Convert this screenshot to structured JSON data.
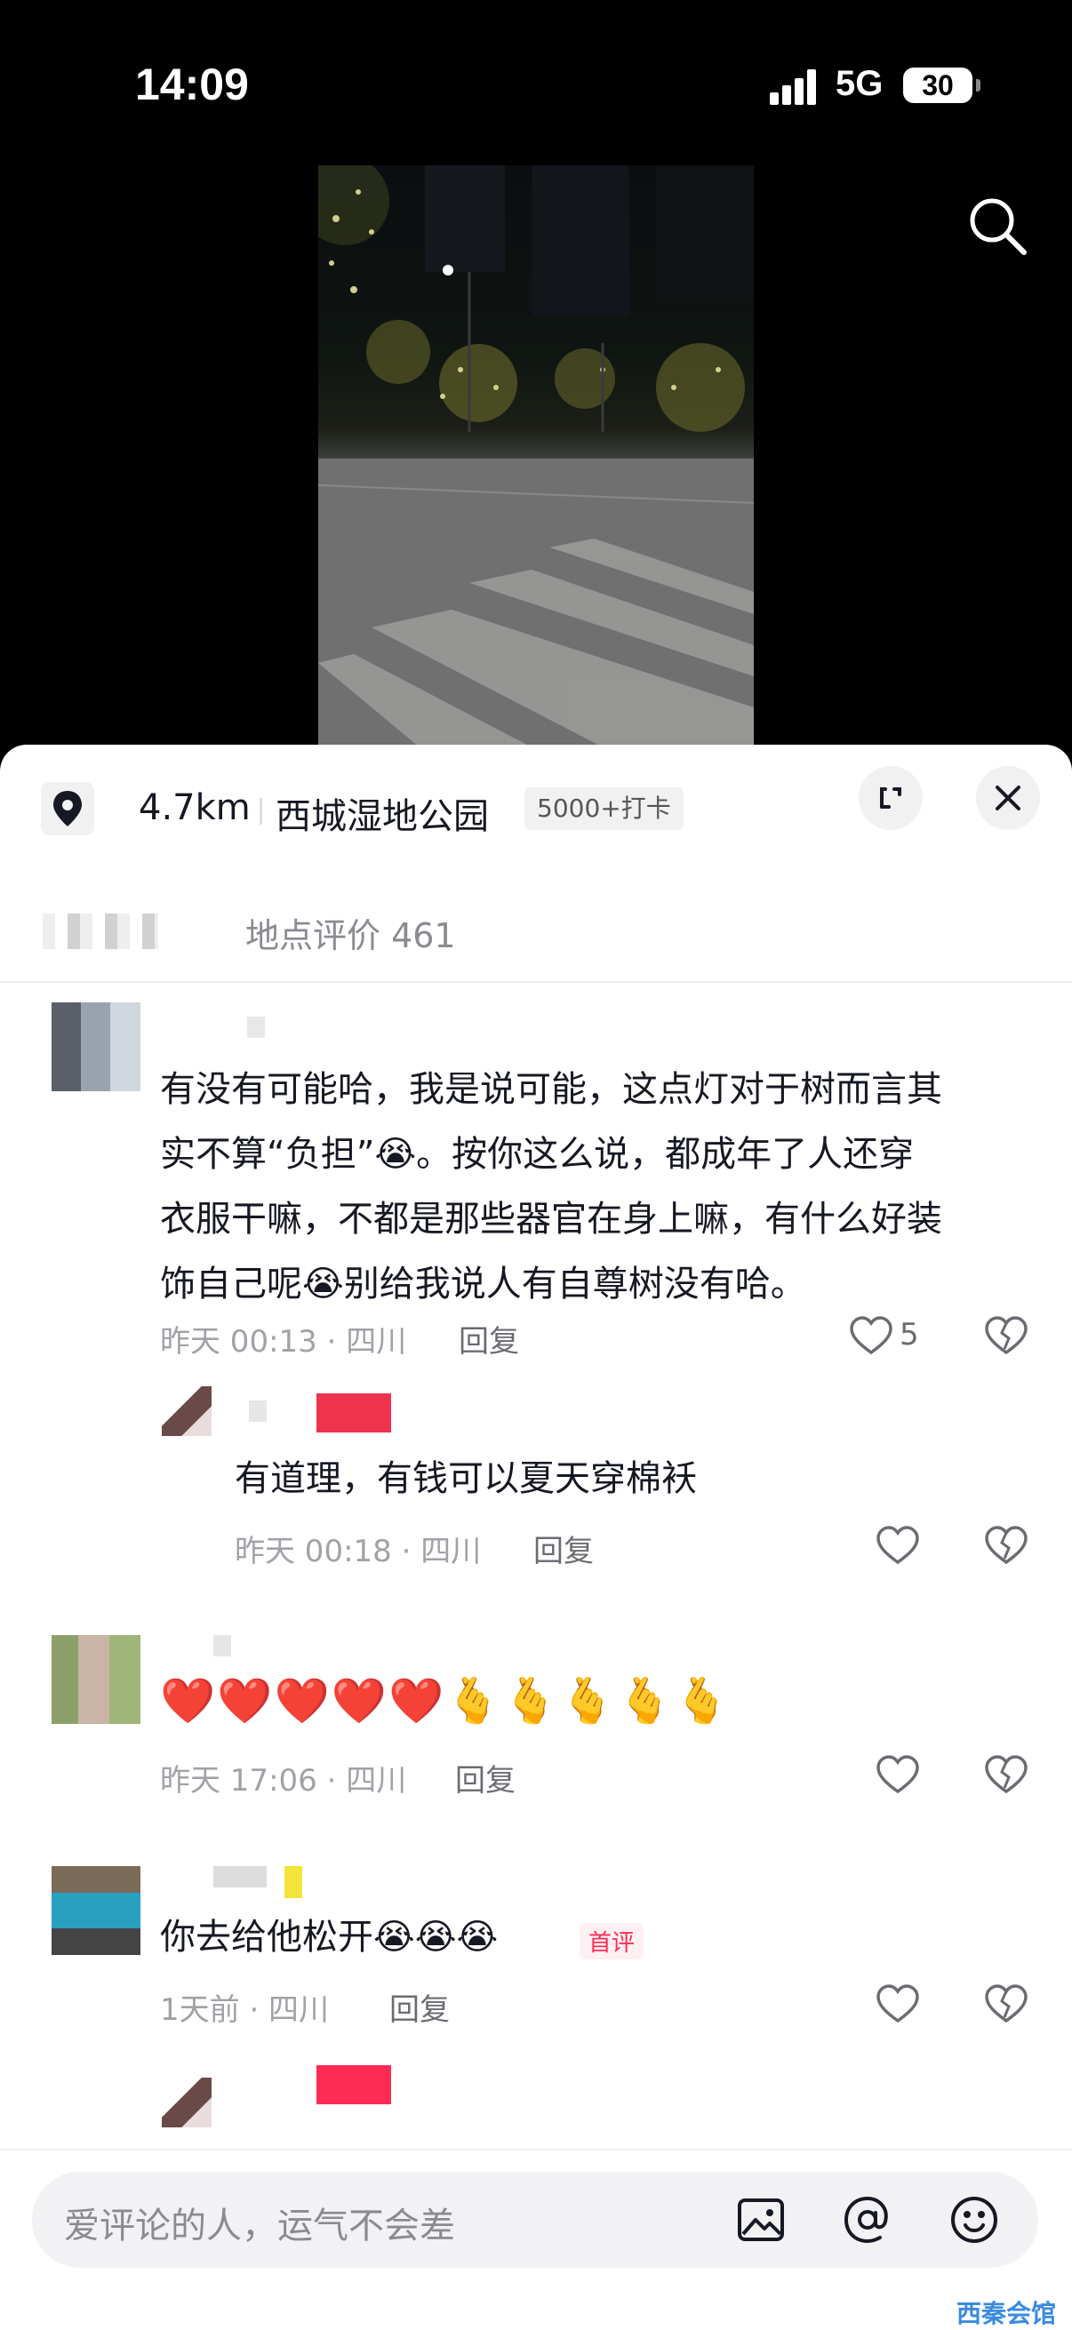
{
  "status_bar": {
    "time": "14:09",
    "network": "5G",
    "battery": "30"
  },
  "location": {
    "distance": "4.7km",
    "place": "西城湿地公园",
    "checkins": "5000+打卡"
  },
  "tabs": {
    "review_label": "地点评价 461"
  },
  "comments": [
    {
      "text_lines": [
        "有没有可能哈，我是说可能，这点灯对于树而言其",
        "实不算“负担”😭。按你这么说，都成年了人还穿",
        "衣服干嘛，不都是那些器官在身上嘛，有什么好装",
        "饰自己呢😭别给我说人有自尊树没有哈。"
      ],
      "meta": "昨天 00:13 · 四川",
      "reply": "回复",
      "likes": "5"
    },
    {
      "text": "有道理，有钱可以夏天穿棉袄",
      "meta": "昨天 00:18 · 四川",
      "reply": "回复"
    },
    {
      "emoji_text": "❤️❤️❤️❤️❤️🫰🫰🫰🫰🫰",
      "meta": "昨天 17:06 · 四川",
      "reply": "回复"
    },
    {
      "text": "你去给他松开😭😭😭",
      "badge": "首评",
      "meta": "1天前 · 四川",
      "reply": "回复"
    }
  ],
  "input": {
    "placeholder": "爱评论的人，运气不会差"
  },
  "watermark": "西秦会馆",
  "icons": [
    "search-icon",
    "location-pin-icon",
    "expand-icon",
    "close-icon",
    "heart-icon",
    "broken-heart-icon",
    "image-icon",
    "at-icon",
    "emoji-icon"
  ]
}
